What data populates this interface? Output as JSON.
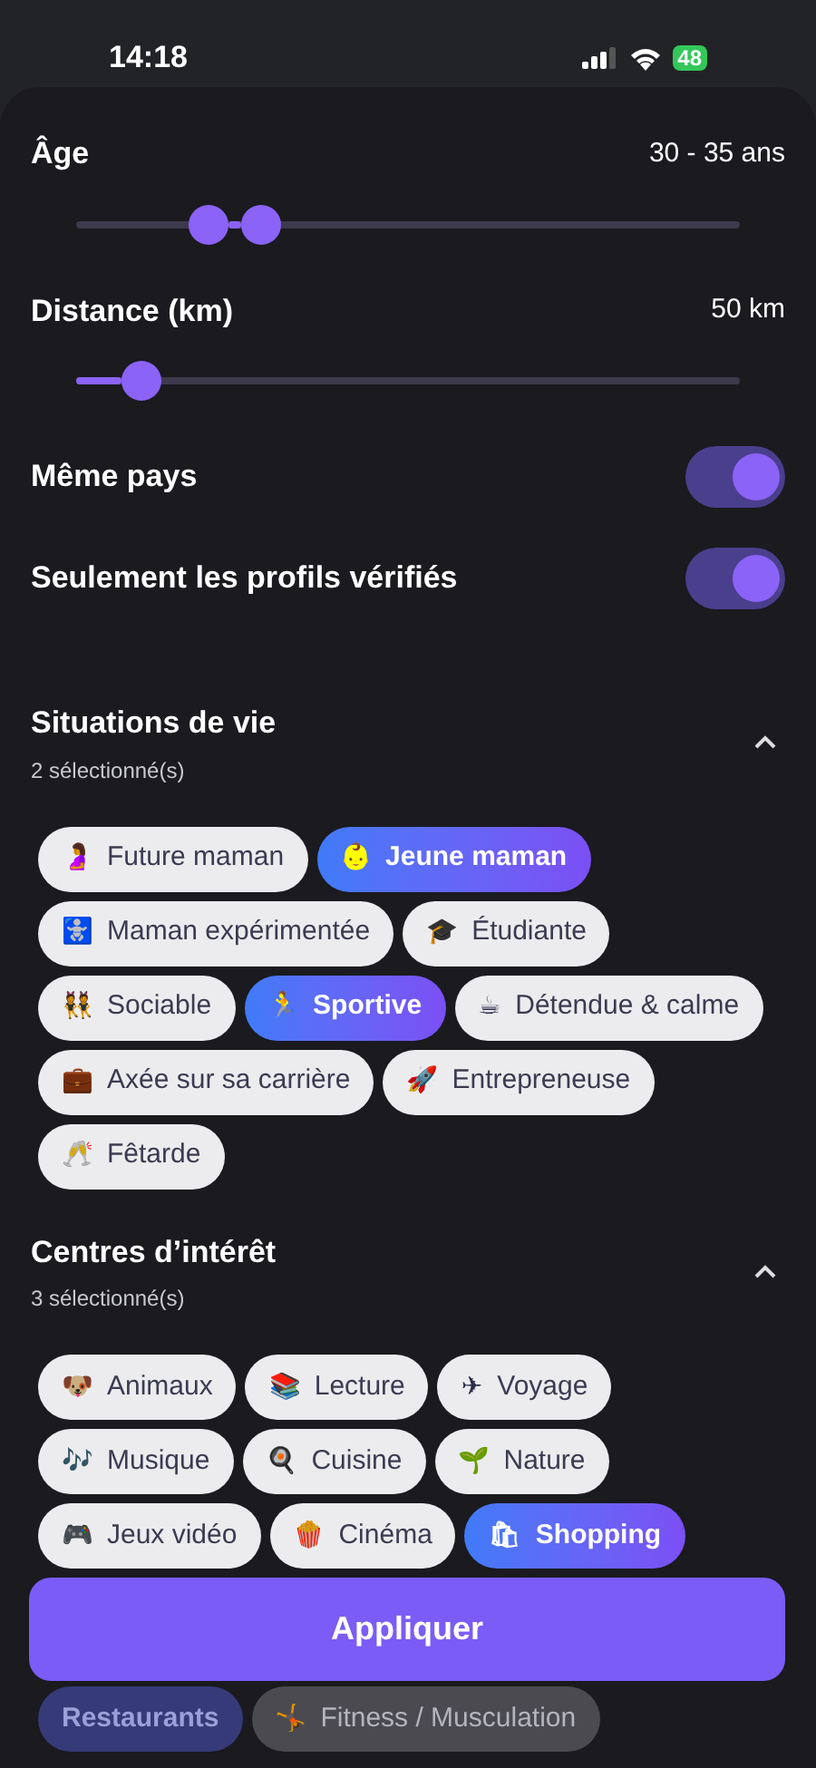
{
  "status_bar": {
    "time": "14:18",
    "battery": "48"
  },
  "sliders": [
    {
      "label": "Âge",
      "reading": "30 - 35 ans",
      "thumbs": [
        {
          "level": 0.2
        },
        {
          "level": 0.28
        }
      ]
    },
    {
      "label": "Distance (km)",
      "reading": "50 km",
      "thumbs": [
        {
          "level": 0.097
        }
      ]
    }
  ],
  "toggles": [
    {
      "label": "Même pays",
      "on": true
    },
    {
      "label": "Seulement les profils vérifiés",
      "on": true
    }
  ],
  "sections": [
    {
      "title": "Situations de vie",
      "count": "2 sélectionné(s)",
      "expanded": true,
      "chips": [
        {
          "emoji": "🤰",
          "label": "Future maman",
          "selected": false
        },
        {
          "emoji": "👶",
          "label": "Jeune maman",
          "selected": true
        },
        {
          "emoji": "🚼",
          "label": "Maman expérimentée",
          "selected": false
        },
        {
          "emoji": "🎓",
          "label": "Étudiante",
          "selected": false
        },
        {
          "emoji": "👯",
          "label": "Sociable",
          "selected": false
        },
        {
          "emoji": "🏃",
          "label": "Sportive",
          "selected": true
        },
        {
          "emoji": "☕",
          "label": "Détendue & calme",
          "selected": false
        },
        {
          "emoji": "💼",
          "label": "Axée sur sa carrière",
          "selected": false
        },
        {
          "emoji": "🚀",
          "label": "Entrepreneuse",
          "selected": false
        },
        {
          "emoji": "🥂",
          "label": "Fêtarde",
          "selected": false
        }
      ]
    },
    {
      "title": "Centres d’intérêt",
      "count": "3 sélectionné(s)",
      "expanded": true,
      "chips": [
        {
          "emoji": "🐶",
          "label": "Animaux",
          "selected": false
        },
        {
          "emoji": "📚",
          "label": "Lecture",
          "selected": false
        },
        {
          "emoji": "✈",
          "label": "Voyage",
          "selected": false
        },
        {
          "emoji": "🎶",
          "label": "Musique",
          "selected": false
        },
        {
          "emoji": "🍳",
          "label": "Cuisine",
          "selected": false
        },
        {
          "emoji": "🌱",
          "label": "Nature",
          "selected": false
        },
        {
          "emoji": "🎮",
          "label": "Jeux vidéo",
          "selected": false
        },
        {
          "emoji": "🍿",
          "label": "Cinéma",
          "selected": false
        },
        {
          "emoji": "🛍",
          "label": "Shopping",
          "selected": true
        }
      ],
      "faded_chips": [
        {
          "label": "Restaurants",
          "selected": true
        },
        {
          "emoji": "🤸",
          "label": "Fitness / Musculation",
          "selected": false
        }
      ]
    }
  ],
  "apply_button": "Appliquer"
}
